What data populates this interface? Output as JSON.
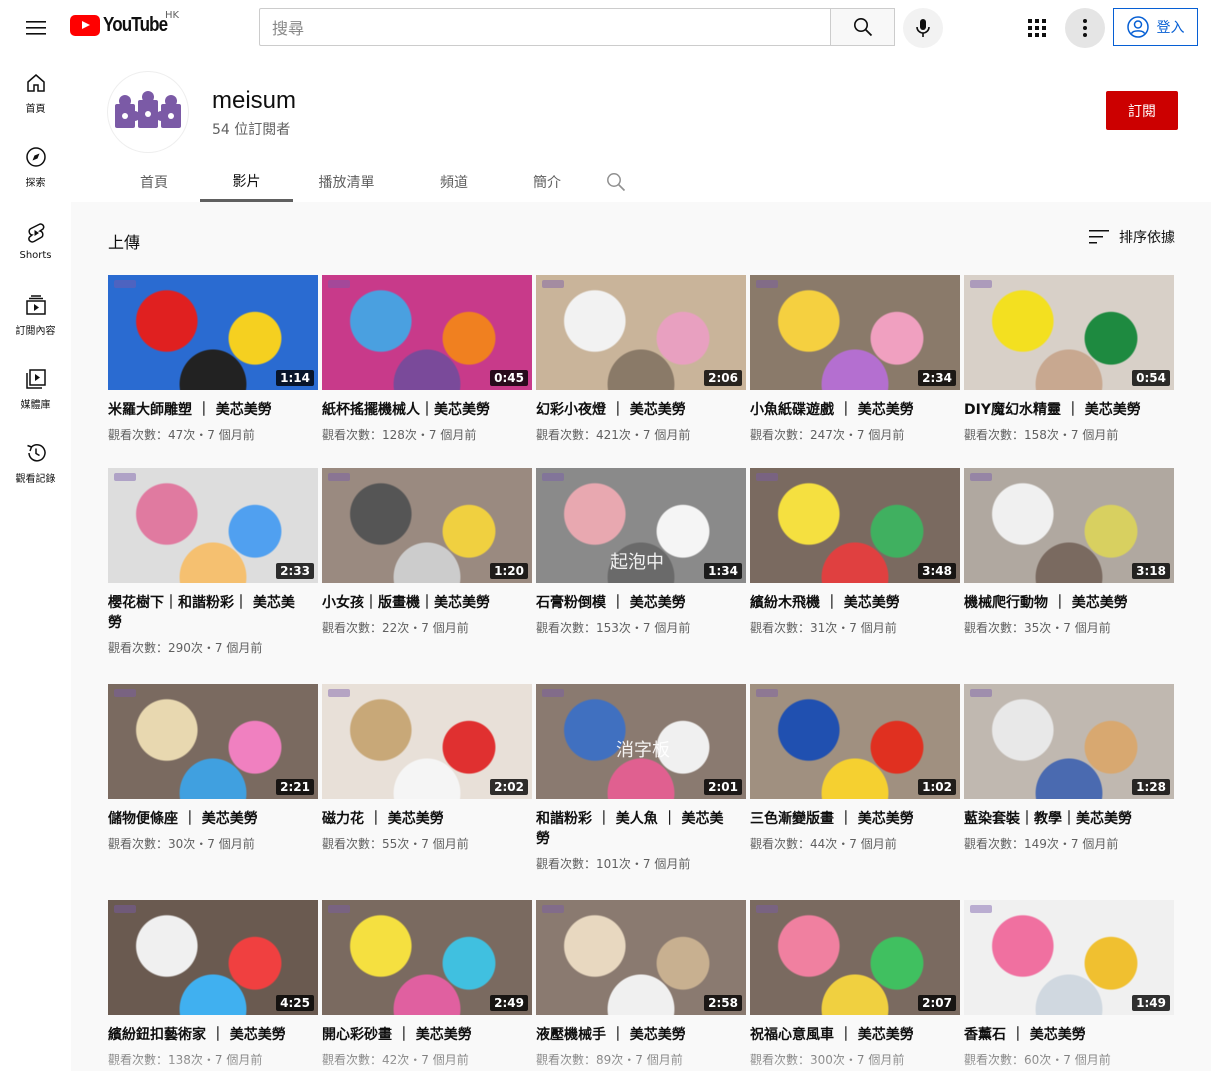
{
  "header": {
    "logo_text": "YouTube",
    "country_code": "HK",
    "search_placeholder": "搜尋",
    "signin_label": "登入"
  },
  "sidebar": {
    "items": [
      {
        "label": "首頁",
        "icon": "home-icon"
      },
      {
        "label": "探索",
        "icon": "explore-icon"
      },
      {
        "label": "Shorts",
        "icon": "shorts-icon"
      },
      {
        "label": "訂閱內容",
        "icon": "subscriptions-icon"
      },
      {
        "label": "媒體庫",
        "icon": "library-icon"
      },
      {
        "label": "觀看記錄",
        "icon": "history-icon"
      }
    ]
  },
  "channel": {
    "name": "meisum",
    "subscribers": "54 位訂閱者",
    "subscribe_label": "訂閱",
    "tabs": [
      "首頁",
      "影片",
      "播放清單",
      "頻道",
      "簡介"
    ],
    "active_tab": "影片"
  },
  "main": {
    "section_title": "上傳",
    "sort_label": "排序依據"
  },
  "videos": [
    {
      "title": "米羅大師雕塑 ｜ 美芯美勞",
      "meta": "觀看次數：47次・7 個月前",
      "duration": "1:14",
      "colors": [
        "#2a6bd1",
        "#e02020",
        "#f5d020",
        "#222"
      ]
    },
    {
      "title": "紙杯搖擺機械人｜美芯美勞",
      "meta": "觀看次數：128次・7 個月前",
      "duration": "0:45",
      "colors": [
        "#c83a8a",
        "#4aa0e0",
        "#f08020",
        "#7a4a9a"
      ]
    },
    {
      "title": "幻彩小夜燈 ｜ 美芯美勞",
      "meta": "觀看次數：421次・7 個月前",
      "duration": "2:06",
      "colors": [
        "#c9b49a",
        "#f2f2f2",
        "#e8a0c0",
        "#8a7a68"
      ]
    },
    {
      "title": "小魚紙碟遊戲 ｜ 美芯美勞",
      "meta": "觀看次數：247次・7 個月前",
      "duration": "2:34",
      "colors": [
        "#8a7a6a",
        "#f5d040",
        "#f0a0c0",
        "#b46fd0"
      ]
    },
    {
      "title": "DIY魔幻水精靈 ｜ 美芯美勞",
      "meta": "觀看次數：158次・7 個月前",
      "duration": "0:54",
      "colors": [
        "#d8d0c8",
        "#f3e020",
        "#1e8a40",
        "#c8a890"
      ]
    },
    {
      "title": "櫻花樹下｜和諧粉彩｜ 美芯美勞",
      "meta": "觀看次數：290次・7 個月前",
      "duration": "2:33",
      "colors": [
        "#ddd",
        "#e07aa0",
        "#50a0f0",
        "#f5c070"
      ]
    },
    {
      "title": "小女孩｜版畫機｜美芯美勞",
      "meta": "觀看次數：22次・7 個月前",
      "duration": "1:20",
      "colors": [
        "#9a8a80",
        "#555",
        "#f0d040",
        "#ccc"
      ]
    },
    {
      "title": "石膏粉倒模 ｜ 美芯美勞",
      "meta": "觀看次數：153次・7 個月前",
      "duration": "1:34",
      "colors": [
        "#8a8a8a",
        "#e8a8b0",
        "#f5f5f5",
        "#6a6a6a"
      ],
      "overlay": "起泡中"
    },
    {
      "title": "繽紛木飛機 ｜ 美芯美勞",
      "meta": "觀看次數：31次・7 個月前",
      "duration": "3:48",
      "colors": [
        "#7a6a60",
        "#f5e040",
        "#40b060",
        "#e04040"
      ]
    },
    {
      "title": "機械爬行動物 ｜ 美芯美勞",
      "meta": "觀看次數：35次・7 個月前",
      "duration": "3:18",
      "colors": [
        "#b0a8a0",
        "#f0f0f0",
        "#d8d060",
        "#7a6a60"
      ]
    },
    {
      "title": "儲物便條座 ｜ 美芯美勞",
      "meta": "觀看次數：30次・7 個月前",
      "duration": "2:21",
      "colors": [
        "#7a6a60",
        "#e8d8b0",
        "#f080c0",
        "#40a0e0"
      ]
    },
    {
      "title": "磁力花 ｜ 美芯美勞",
      "meta": "觀看次數：55次・7 個月前",
      "duration": "2:02",
      "colors": [
        "#e8e0d8",
        "#c8a878",
        "#e03030",
        "#f5f5f5"
      ]
    },
    {
      "title": "和諧粉彩 ｜ 美人魚 ｜ 美芯美勞",
      "meta": "觀看次數：101次・7 個月前",
      "duration": "2:01",
      "colors": [
        "#8a7a70",
        "#4070c0",
        "#f0f0f0",
        "#e06090"
      ],
      "overlay": "消字板"
    },
    {
      "title": "三色漸變版畫 ｜ 美芯美勞",
      "meta": "觀看次數：44次・7 個月前",
      "duration": "1:02",
      "colors": [
        "#a09080",
        "#2050b0",
        "#e03020",
        "#f5d030"
      ]
    },
    {
      "title": "藍染套裝｜教學｜美芯美勞",
      "meta": "觀看次數：149次・7 個月前",
      "duration": "1:28",
      "colors": [
        "#c0b8b0",
        "#e8e8e8",
        "#d8a870",
        "#4a6ab0"
      ]
    },
    {
      "title": "繽紛鈕扣藝術家 ｜ 美芯美勞",
      "meta": "觀看次數：138次・7 個月前",
      "duration": "4:25",
      "colors": [
        "#6a5a50",
        "#f0f0f0",
        "#f04040",
        "#40b0f0"
      ]
    },
    {
      "title": "開心彩砂畫 ｜ 美芯美勞",
      "meta": "觀看次數：42次・7 個月前",
      "duration": "2:49",
      "colors": [
        "#7a6a60",
        "#f5e040",
        "#40c0e0",
        "#e060a0"
      ]
    },
    {
      "title": "液壓機械手 ｜ 美芯美勞",
      "meta": "觀看次數：89次・7 個月前",
      "duration": "2:58",
      "colors": [
        "#8a7a70",
        "#e8d8c0",
        "#c8b090",
        "#f0f0f0"
      ]
    },
    {
      "title": "祝福心意風車 ｜ 美芯美勞",
      "meta": "觀看次數：300次・7 個月前",
      "duration": "2:07",
      "colors": [
        "#7a6a60",
        "#f080a0",
        "#40c060",
        "#f0d040"
      ]
    },
    {
      "title": "香薰石 ｜ 美芯美勞",
      "meta": "觀看次數：60次・7 個月前",
      "duration": "1:49",
      "colors": [
        "#f0f0f0",
        "#f070a0",
        "#f0c030",
        "#d0d8e0"
      ]
    }
  ]
}
